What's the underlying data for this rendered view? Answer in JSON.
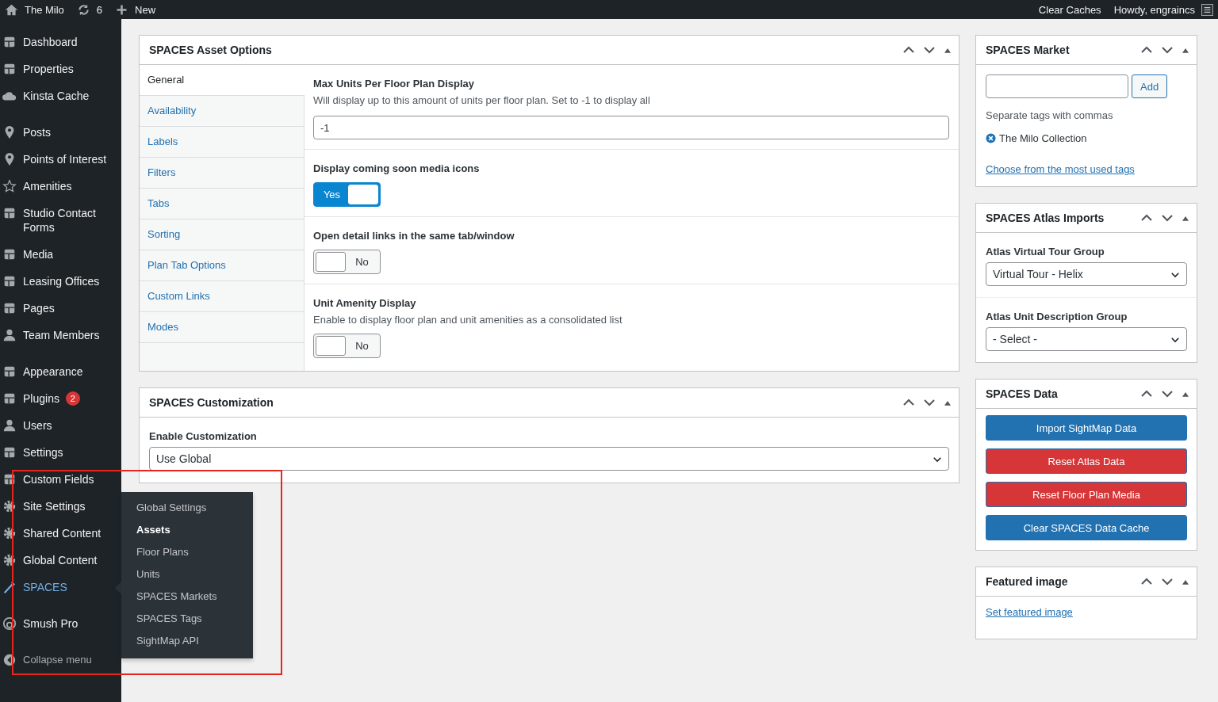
{
  "admin_bar": {
    "site": "The Milo",
    "updates": "6",
    "new": "New",
    "clear_caches": "Clear Caches",
    "greeting": "Howdy, engraincs"
  },
  "sidebar": {
    "groups": [
      {
        "items": [
          {
            "label": "Dashboard",
            "selected": false
          },
          {
            "label": "Properties",
            "selected": false
          },
          {
            "label": "Kinsta Cache",
            "selected": false
          }
        ]
      },
      {
        "items": [
          {
            "label": "Posts",
            "selected": false
          },
          {
            "label": "Points of Interest",
            "selected": false
          },
          {
            "label": "Amenities",
            "selected": false
          },
          {
            "label": "Studio Contact Forms",
            "selected": false
          },
          {
            "label": "Media",
            "selected": false
          },
          {
            "label": "Leasing Offices",
            "selected": false
          },
          {
            "label": "Pages",
            "selected": false
          },
          {
            "label": "Team Members",
            "selected": false
          }
        ]
      },
      {
        "items": [
          {
            "label": "Appearance",
            "selected": false
          },
          {
            "label": "Plugins",
            "selected": false,
            "badge": "2"
          },
          {
            "label": "Users",
            "selected": false
          },
          {
            "label": "Settings",
            "selected": false
          },
          {
            "label": "Custom Fields",
            "selected": false
          },
          {
            "label": "Site Settings",
            "selected": false
          },
          {
            "label": "Shared Content",
            "selected": false
          },
          {
            "label": "Global Content",
            "selected": false
          },
          {
            "label": "SPACES",
            "selected": true
          }
        ]
      },
      {
        "items": [
          {
            "label": "Smush Pro",
            "selected": false
          }
        ]
      }
    ],
    "collapse": "Collapse menu",
    "flyout": [
      {
        "label": "Global Settings",
        "selected": false
      },
      {
        "label": "Assets",
        "selected": true
      },
      {
        "label": "Floor Plans",
        "selected": false
      },
      {
        "label": "Units",
        "selected": false
      },
      {
        "label": "SPACES Markets",
        "selected": false
      },
      {
        "label": "SPACES Tags",
        "selected": false
      },
      {
        "label": "SightMap API",
        "selected": false
      }
    ]
  },
  "asset_options": {
    "title": "SPACES Asset Options",
    "tabs": [
      {
        "label": "General",
        "selected": true
      },
      {
        "label": "Availability",
        "selected": false
      },
      {
        "label": "Labels",
        "selected": false
      },
      {
        "label": "Filters",
        "selected": false
      },
      {
        "label": "Tabs",
        "selected": false
      },
      {
        "label": "Sorting",
        "selected": false
      },
      {
        "label": "Plan Tab Options",
        "selected": false
      },
      {
        "label": "Custom Links",
        "selected": false
      },
      {
        "label": "Modes",
        "selected": false
      }
    ],
    "fields": [
      {
        "kind": "text",
        "label": "Max Units Per Floor Plan Display",
        "description": "Will display up to this amount of units per floor plan. Set to -1 to display all",
        "value": "-1"
      },
      {
        "kind": "toggle",
        "label": "Display coming soon media icons",
        "on": true,
        "state_label": "Yes"
      },
      {
        "kind": "toggle",
        "label": "Open detail links in the same tab/window",
        "on": false,
        "state_label": "No"
      },
      {
        "kind": "toggle",
        "label": "Unit Amenity Display",
        "description": "Enable to display floor plan and unit amenities as a consolidated list",
        "on": false,
        "state_label": "No"
      }
    ]
  },
  "customization": {
    "title": "SPACES Customization",
    "label": "Enable Customization",
    "value": "Use Global"
  },
  "market": {
    "title": "SPACES Market",
    "add": "Add",
    "hint": "Separate tags with commas",
    "tag": "The Milo Collection",
    "link": "Choose from the most used tags"
  },
  "atlas": {
    "title": "SPACES Atlas Imports",
    "selects": [
      {
        "label": "Atlas Virtual Tour Group",
        "value": "Virtual Tour - Helix"
      },
      {
        "label": "Atlas Unit Description Group",
        "value": "- Select -"
      }
    ]
  },
  "data": {
    "title": "SPACES Data",
    "buttons": [
      {
        "label": "Import SightMap Data",
        "kind": "primary"
      },
      {
        "label": "Reset Atlas Data",
        "kind": "danger"
      },
      {
        "label": "Reset Floor Plan Media",
        "kind": "danger"
      },
      {
        "label": "Clear SPACES Data Cache",
        "kind": "primary"
      }
    ]
  },
  "featured": {
    "title": "Featured image",
    "link": "Set featured image"
  },
  "annotation": {
    "kind": "rectangle"
  }
}
